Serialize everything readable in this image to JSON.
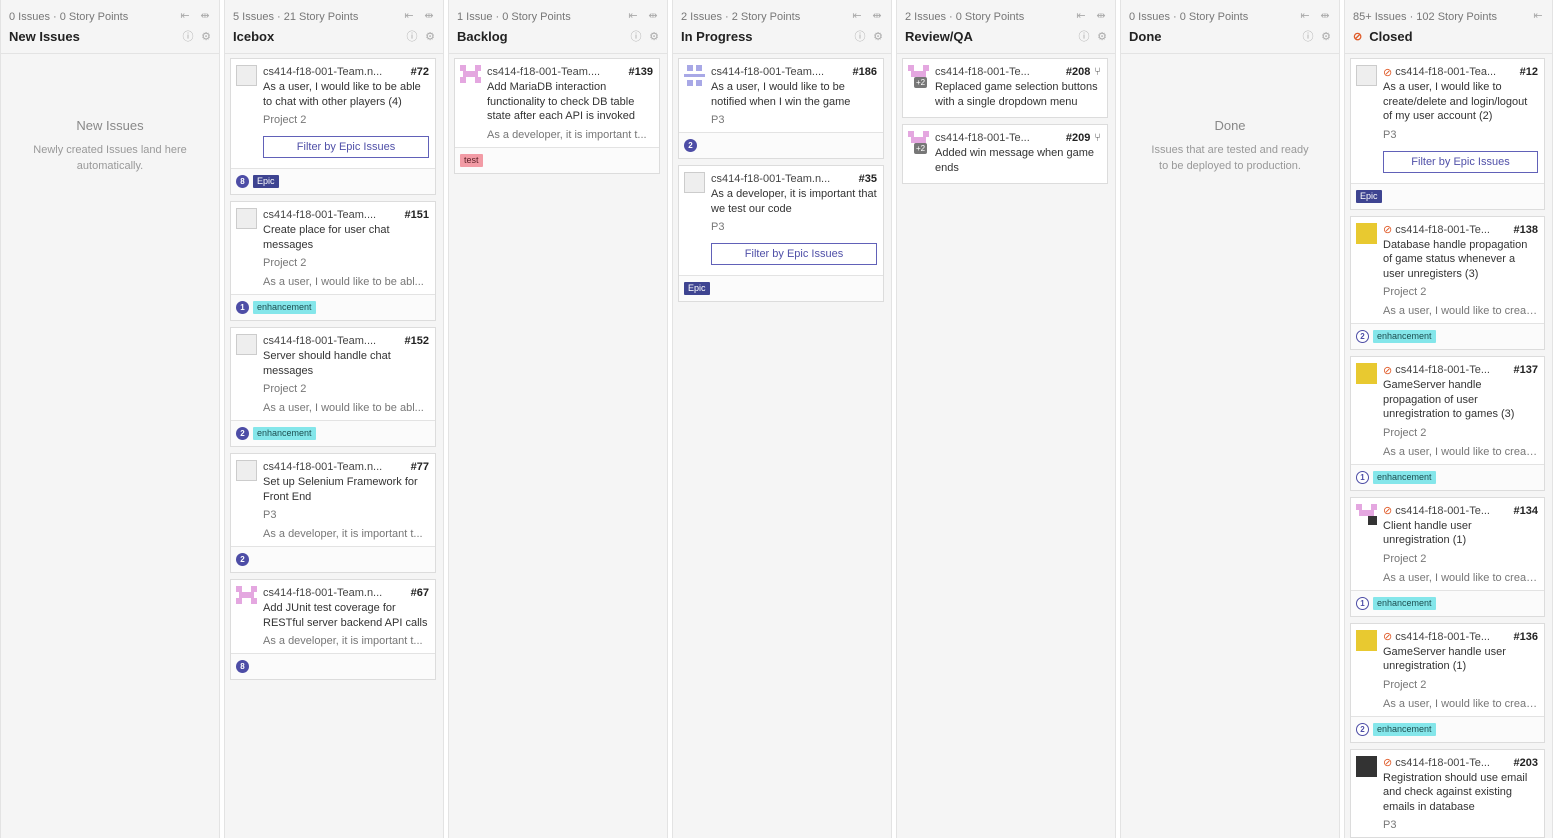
{
  "columns": [
    {
      "meta": "0 Issues · 0 Story Points",
      "title": "New Issues",
      "empty": {
        "title": "New Issues",
        "desc": "Newly created Issues land here automatically."
      },
      "cards": []
    },
    {
      "meta": "5 Issues · 21 Story Points",
      "title": "Icebox",
      "cards": [
        {
          "repo": "cs414-f18-001-Team.n...",
          "num": "#72",
          "title": "As a user, I would like to be able to chat with other players (4)",
          "milestone": "Project 2",
          "filter": "Filter by Epic Issues",
          "points": "8",
          "labels": [
            "Epic"
          ]
        },
        {
          "repo": "cs414-f18-001-Team....",
          "num": "#151",
          "title": "Create place for user chat messages",
          "milestone": "Project 2",
          "epic": "As a user, I would like to be abl...",
          "points": "1",
          "labels": [
            "enhancement"
          ]
        },
        {
          "repo": "cs414-f18-001-Team....",
          "num": "#152",
          "title": "Server should handle chat messages",
          "milestone": "Project 2",
          "epic": "As a user, I would like to be abl...",
          "points": "2",
          "labels": [
            "enhancement"
          ]
        },
        {
          "repo": "cs414-f18-001-Team.n...",
          "num": "#77",
          "title": "Set up Selenium Framework for Front End",
          "milestone": "P3",
          "epic": "As a developer, it is important t...",
          "points": "2",
          "labels": []
        },
        {
          "repo": "cs414-f18-001-Team.n...",
          "num": "#67",
          "title": "Add JUnit test coverage for RESTful server backend API calls",
          "epic": "As a developer, it is important t...",
          "points": "8",
          "labels": []
        }
      ]
    },
    {
      "meta": "1 Issue · 0 Story Points",
      "title": "Backlog",
      "cards": [
        {
          "repo": "cs414-f18-001-Team....",
          "num": "#139",
          "title": "Add MariaDB interaction functionality to check DB table state after each API is invoked",
          "epic": "As a developer, it is important t...",
          "labels": [
            "test"
          ]
        }
      ]
    },
    {
      "meta": "2 Issues · 2 Story Points",
      "title": "In Progress",
      "cards": [
        {
          "repo": "cs414-f18-001-Team....",
          "num": "#186",
          "title": "As a user, I would like to be notified when I win the game",
          "milestone": "P3",
          "points": "2",
          "labels": []
        },
        {
          "repo": "cs414-f18-001-Team.n...",
          "num": "#35",
          "title": "As a developer, it is important that we test our code",
          "milestone": "P3",
          "filter": "Filter by Epic Issues",
          "labels": [
            "Epic"
          ]
        }
      ]
    },
    {
      "meta": "2 Issues · 0 Story Points",
      "title": "Review/QA",
      "cards": [
        {
          "repo": "cs414-f18-001-Te...",
          "num": "#208",
          "title": "Replaced game selection buttons with a single dropdown menu",
          "plus": "+2",
          "labels": []
        },
        {
          "repo": "cs414-f18-001-Te...",
          "num": "#209",
          "title": "Added win message when game ends",
          "plus": "+2",
          "labels": []
        }
      ]
    },
    {
      "meta": "0 Issues · 0 Story Points",
      "title": "Done",
      "empty": {
        "title": "Done",
        "desc": "Issues that are tested and ready to be deployed to production."
      },
      "cards": []
    },
    {
      "meta": "85+ Issues · 102 Story Points",
      "title": "Closed",
      "cards": [
        {
          "repo": "cs414-f18-001-Tea...",
          "num": "#12",
          "title": "As a user, I would like to create/delete and login/logout of my user account (2)",
          "milestone": "P3",
          "filter": "Filter by Epic Issues",
          "labels": [
            "Epic"
          ]
        },
        {
          "repo": "cs414-f18-001-Te...",
          "num": "#138",
          "title": "Database handle propagation of game status whenever a user unregisters (3)",
          "milestone": "Project 2",
          "epic": "As a user, I would like to create/...",
          "points": "2",
          "labels": [
            "enhancement"
          ]
        },
        {
          "repo": "cs414-f18-001-Te...",
          "num": "#137",
          "title": "GameServer handle propagation of user unregistration to games (3)",
          "milestone": "Project 2",
          "epic": "As a user, I would like to create/...",
          "points": "1",
          "labels": [
            "enhancement"
          ]
        },
        {
          "repo": "cs414-f18-001-Te...",
          "num": "#134",
          "title": "Client handle user unregistration (1)",
          "milestone": "Project 2",
          "epic": "As a user, I would like to create/...",
          "points": "1",
          "labels": [
            "enhancement"
          ]
        },
        {
          "repo": "cs414-f18-001-Te...",
          "num": "#136",
          "title": "GameServer handle user unregistration (1)",
          "milestone": "Project 2",
          "epic": "As a user, I would like to create/...",
          "points": "2",
          "labels": [
            "enhancement"
          ]
        },
        {
          "repo": "cs414-f18-001-Te...",
          "num": "#203",
          "title": "Registration should use email and check against existing emails in database",
          "milestone": "P3",
          "labels": []
        }
      ]
    }
  ]
}
